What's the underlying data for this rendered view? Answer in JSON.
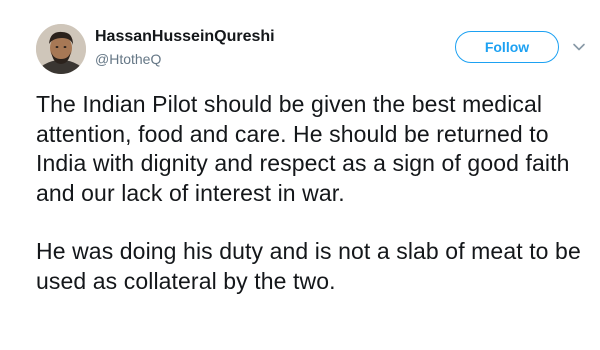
{
  "user": {
    "display_name": "HassanHusseinQureshi",
    "handle": "@HtotheQ",
    "avatar_icon": "avatar-photo-icon"
  },
  "actions": {
    "follow_label": "Follow",
    "more_icon": "chevron-down-icon"
  },
  "tweet": {
    "paragraphs": [
      "The Indian Pilot should be given the best medical attention, food and care. He should be returned to India with dignity and respect as a sign of good faith and our lack of interest in war.",
      "He was doing his duty and is not a slab of meat to be used as collateral by the two."
    ]
  },
  "colors": {
    "accent": "#1da1f2",
    "text": "#14171a",
    "secondary_text": "#657786"
  }
}
